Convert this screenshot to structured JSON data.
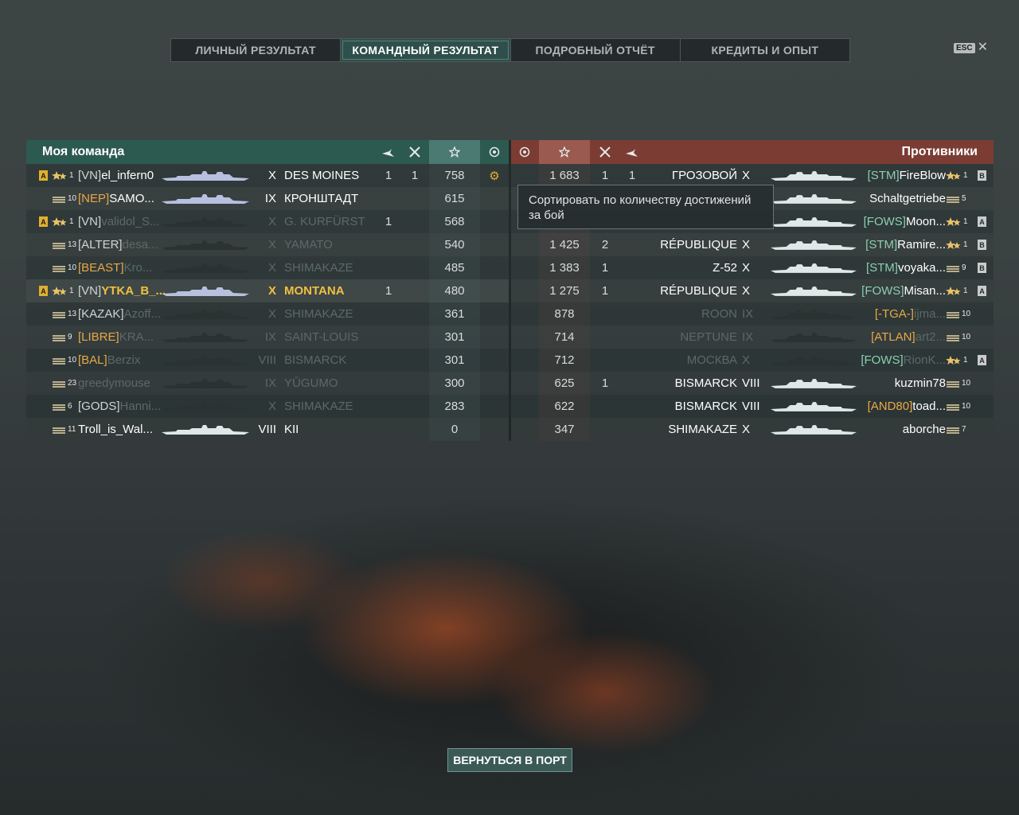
{
  "tabs": [
    {
      "label": "ЛИЧНЫЙ РЕЗУЛЬТАТ",
      "active": false
    },
    {
      "label": "КОМАНДНЫЙ РЕЗУЛЬТАТ",
      "active": true
    },
    {
      "label": "ПОДРОБНЫЙ ОТЧЁТ",
      "active": false
    },
    {
      "label": "КРЕДИТЫ И ОПЫТ",
      "active": false
    }
  ],
  "esc": {
    "key": "ESC",
    "close": "✕"
  },
  "left": {
    "title": "Моя команда",
    "rows": [
      {
        "badge": "A",
        "lvl": "1",
        "clan": "[VN]",
        "nick": "el_infern0",
        "tier": "X",
        "ship": "DES MOINES",
        "planes": "1",
        "ships": "1",
        "xp": "758",
        "ach": "⚙",
        "state": "mine"
      },
      {
        "badge": "",
        "lvl": "10",
        "clan": "[NEP]",
        "nick": "SAMO...",
        "tier": "IX",
        "ship": "КРОНШТАДТ",
        "planes": "",
        "ships": "",
        "xp": "615",
        "ach": "",
        "state": "mine"
      },
      {
        "badge": "A",
        "lvl": "1",
        "clan": "[VN]",
        "nick": "validol_S...",
        "tier": "X",
        "ship": "G. KURFÜRST",
        "planes": "1",
        "ships": "",
        "xp": "568",
        "ach": "",
        "state": "dead"
      },
      {
        "badge": "",
        "lvl": "13",
        "clan": "[ALTER]",
        "nick": "desa...",
        "tier": "X",
        "ship": "YAMATO",
        "planes": "",
        "ships": "",
        "xp": "540",
        "ach": "",
        "state": "dead"
      },
      {
        "badge": "",
        "lvl": "10",
        "clan": "[BEAST]",
        "nick": "Kro...",
        "tier": "X",
        "ship": "SHIMAKAZE",
        "planes": "",
        "ships": "",
        "xp": "485",
        "ach": "",
        "state": "dead"
      },
      {
        "badge": "A",
        "lvl": "1",
        "clan": "[VN]",
        "nick": "YTKA_B_...",
        "tier": "X",
        "ship": "MONTANA",
        "planes": "1",
        "ships": "",
        "xp": "480",
        "ach": "",
        "state": "gold"
      },
      {
        "badge": "",
        "lvl": "13",
        "clan": "[KAZAK]",
        "nick": "Azoff...",
        "tier": "X",
        "ship": "SHIMAKAZE",
        "planes": "",
        "ships": "",
        "xp": "361",
        "ach": "",
        "state": "dead"
      },
      {
        "badge": "",
        "lvl": "9",
        "clan": "[LIBRE]",
        "nick": "KRA...",
        "tier": "IX",
        "ship": "SAINT-LOUIS",
        "planes": "",
        "ships": "",
        "xp": "301",
        "ach": "",
        "state": "dead"
      },
      {
        "badge": "",
        "lvl": "10",
        "clan": "[BAL]",
        "nick": "Berzix",
        "tier": "VIII",
        "ship": "BISMARCK",
        "planes": "",
        "ships": "",
        "xp": "301",
        "ach": "",
        "state": "dead"
      },
      {
        "badge": "",
        "lvl": "23",
        "clan": "",
        "nick": "greedymouse",
        "tier": "IX",
        "ship": "YŪGUMO",
        "planes": "",
        "ships": "",
        "xp": "300",
        "ach": "",
        "state": "dead"
      },
      {
        "badge": "",
        "lvl": "6",
        "clan": "[GODS]",
        "nick": "Hanni...",
        "tier": "X",
        "ship": "SHIMAKAZE",
        "planes": "",
        "ships": "",
        "xp": "283",
        "ach": "",
        "state": "dead"
      },
      {
        "badge": "",
        "lvl": "11",
        "clan": "",
        "nick": "Troll_is_Wal...",
        "tier": "VIII",
        "ship": "KII",
        "planes": "",
        "ships": "",
        "xp": "0",
        "ach": "",
        "state": "alive"
      }
    ]
  },
  "right": {
    "title": "Противники",
    "rows": [
      {
        "xp": "1 683",
        "ships": "1",
        "planes": "1",
        "ship": "ГРОЗОВОЙ",
        "tier": "X",
        "clan": "[STM]",
        "nick": "FireBlow",
        "lvl": "1",
        "badge": "B",
        "state": "alive"
      },
      {
        "xp": "",
        "ships": "",
        "planes": "",
        "ship": "",
        "tier": "",
        "clan": "",
        "nick": "Schaltgetriebe",
        "lvl": "5",
        "badge": "",
        "state": "alive"
      },
      {
        "xp": "",
        "ships": "",
        "planes": "",
        "ship": "",
        "tier": "",
        "clan": "[FOWS]",
        "nick": "Moon...",
        "lvl": "1",
        "badge": "A",
        "state": "alive"
      },
      {
        "xp": "1 425",
        "ships": "2",
        "planes": "",
        "ship": "RÉPUBLIQUE",
        "tier": "X",
        "clan": "[STM]",
        "nick": "Ramire...",
        "lvl": "1",
        "badge": "B",
        "state": "alive"
      },
      {
        "xp": "1 383",
        "ships": "1",
        "planes": "",
        "ship": "Z-52",
        "tier": "X",
        "clan": "[STM]",
        "nick": "voyaka...",
        "lvl": "9",
        "badge": "B",
        "state": "alive"
      },
      {
        "xp": "1 275",
        "ships": "1",
        "planes": "",
        "ship": "RÉPUBLIQUE",
        "tier": "X",
        "clan": "[FOWS]",
        "nick": "Misan...",
        "lvl": "1",
        "badge": "A",
        "state": "alive"
      },
      {
        "xp": "878",
        "ships": "",
        "planes": "",
        "ship": "ROON",
        "tier": "IX",
        "clan": "[-TGA-]",
        "nick": "ijma...",
        "lvl": "10",
        "badge": "",
        "state": "dead"
      },
      {
        "xp": "714",
        "ships": "",
        "planes": "",
        "ship": "NEPTUNE",
        "tier": "IX",
        "clan": "[ATLAN]",
        "nick": "art2...",
        "lvl": "10",
        "badge": "",
        "state": "dead"
      },
      {
        "xp": "712",
        "ships": "",
        "planes": "",
        "ship": "МОСКВА",
        "tier": "X",
        "clan": "[FOWS]",
        "nick": "RionK...",
        "lvl": "1",
        "badge": "A",
        "state": "dead"
      },
      {
        "xp": "625",
        "ships": "1",
        "planes": "",
        "ship": "BISMARCK",
        "tier": "VIII",
        "clan": "",
        "nick": "kuzmin78",
        "lvl": "10",
        "badge": "",
        "state": "alive"
      },
      {
        "xp": "622",
        "ships": "",
        "planes": "",
        "ship": "BISMARCK",
        "tier": "VIII",
        "clan": "[AND80]",
        "nick": "toad...",
        "lvl": "10",
        "badge": "",
        "state": "alive"
      },
      {
        "xp": "347",
        "ships": "",
        "planes": "",
        "ship": "SHIMAKAZE",
        "tier": "X",
        "clan": "",
        "nick": "aborche",
        "lvl": "7",
        "badge": "",
        "state": "alive"
      }
    ]
  },
  "tooltip": "Сортировать по количеству достижений за бой",
  "back_button": "ВЕРНУТЬСЯ В ПОРТ",
  "icons": {
    "planes": "plane-icon",
    "ships": "crossed-swords-icon",
    "xp": "star-icon",
    "achievements": "achievement-icon"
  }
}
